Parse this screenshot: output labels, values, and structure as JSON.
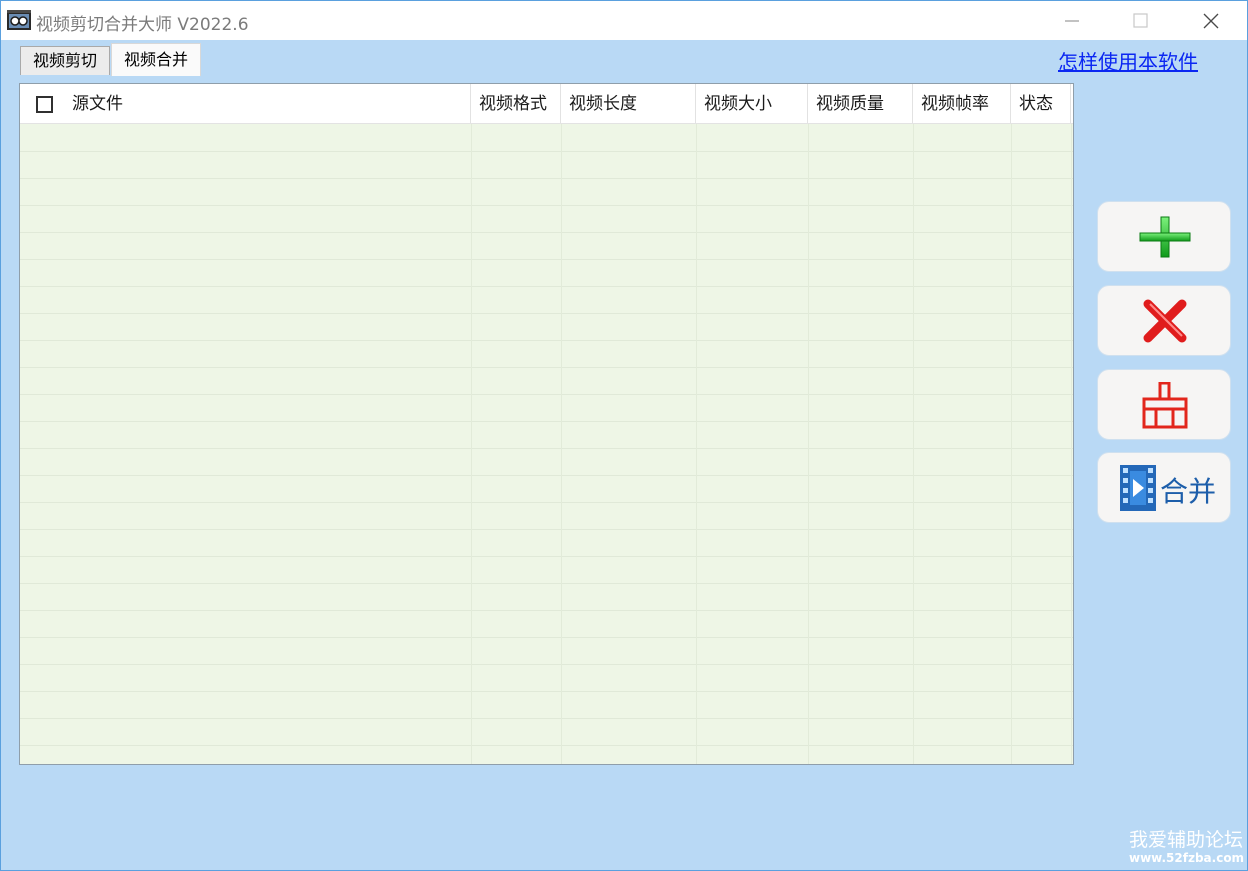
{
  "window": {
    "title": "视频剪切合并大师 V2022.6",
    "min_icon": "minimize-icon",
    "max_icon": "maximize-icon",
    "close_icon": "close-icon"
  },
  "tabs": [
    {
      "label": "视频剪切",
      "active": false
    },
    {
      "label": "视频合并",
      "active": true
    }
  ],
  "help_link": "怎样使用本软件",
  "table": {
    "columns": [
      "源文件",
      "视频格式",
      "视频长度",
      "视频大小",
      "视频质量",
      "视频帧率",
      "状态"
    ],
    "select_all_checked": false,
    "rows": []
  },
  "side_buttons": [
    {
      "name": "add-button",
      "icon": "plus-icon"
    },
    {
      "name": "delete-button",
      "icon": "red-x-icon"
    },
    {
      "name": "clear-button",
      "icon": "broom-icon"
    },
    {
      "name": "merge-button",
      "icon": "film-play-icon",
      "label": "合并"
    }
  ],
  "colors": {
    "background": "#b9d9f5",
    "table_body": "#eef6e6",
    "link": "#0b27f2",
    "merge_text": "#1d5eaa"
  },
  "watermark": {
    "line1": "我爱辅助论坛",
    "line2": "www.52fzba.com"
  }
}
